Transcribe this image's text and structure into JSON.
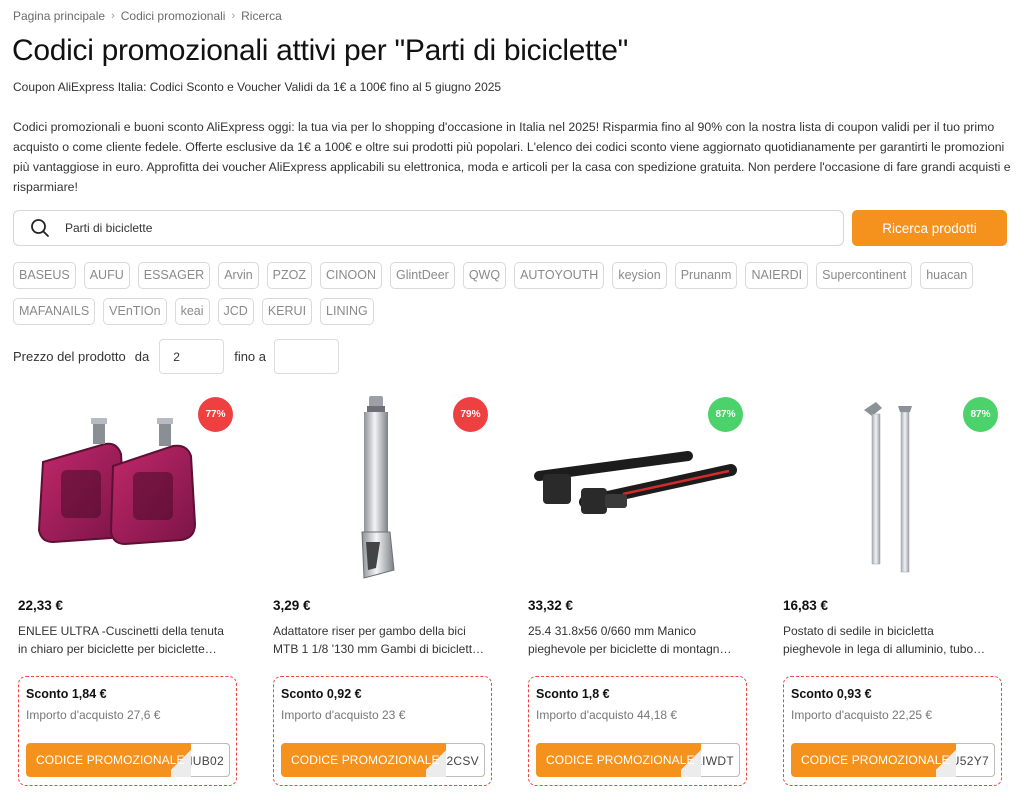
{
  "breadcrumb": {
    "items": [
      "Pagina principale",
      "Codici promozionali",
      "Ricerca"
    ],
    "separator": ">"
  },
  "page": {
    "title": "Codici promozionali attivi per \"Parti di biciclette\"",
    "subtitle": "Coupon AliExpress Italia: Codici Sconto e Voucher Validi da 1€ a 100€ fino al 5 giugno 2025",
    "intro": "Codici promozionali e buoni sconto AliExpress oggi: la tua via per lo shopping d'occasione in Italia nel 2025! Risparmia fino al 90% con la nostra lista di coupon validi per il tuo primo acquisto o come cliente fedele. Offerte esclusive da 1€ a 100€ e oltre sui prodotti più popolari. L'elenco dei codici sconto viene aggiornato quotidianamente per garantirti le promozioni più vantaggiose in euro. Approfitta dei voucher AliExpress applicabili su elettronica, moda e articoli per la casa con spedizione gratuita. Non perdere l'occasione di fare grandi acquisti e risparmiare!"
  },
  "search": {
    "value": "Parti di biciclette",
    "button_label": "Ricerca prodotti",
    "icon": "search-icon"
  },
  "brands": {
    "row1": [
      "BASEUS",
      "AUFU",
      "ESSAGER",
      "Arvin",
      "PZOZ",
      "CINOON",
      "GlintDeer",
      "QWQ",
      "AUTOYOUTH",
      "keysion",
      "Prunanm",
      "NAIERDI",
      "Supercontinent",
      "huacan"
    ],
    "row2": [
      "MAFANAILS",
      "VEnTIOn",
      "keai",
      "JCD",
      "KERUI",
      "LINING"
    ]
  },
  "price_filter": {
    "label": "Prezzo del prodotto",
    "from_label": "da",
    "from_value": "2",
    "to_label": "fino a",
    "to_value": ""
  },
  "colors": {
    "accent": "#f5921e",
    "badge_red": "#ee4040",
    "badge_green": "#4cd26b",
    "coupon_border": "#e44444"
  },
  "products": [
    {
      "badge": "77%",
      "badge_color": "red",
      "price": "22,33 €",
      "title_line1": "ENLEE ULTRA -Cuscinetti della tenuta",
      "title_line2": "in chiaro per biciclette per biciclette…",
      "discount": "Sconto 1,84 €",
      "min_purchase": "Importo d'acquisto 27,6 €",
      "code_label": "CODICE PROMOZIONALE",
      "code": "HUB02",
      "image": "pedals-image"
    },
    {
      "badge": "79%",
      "badge_color": "red",
      "price": "3,29 €",
      "title_line1": "Adattatore riser per gambo della bici",
      "title_line2": "MTB 1 1/8 '130 mm Gambi di biciclett…",
      "discount": "Sconto 0,92 €",
      "min_purchase": "Importo d'acquisto 23 €",
      "code_label": "CODICE PROMOZIONALE",
      "code": "F2CSV",
      "image": "stem-riser-image"
    },
    {
      "badge": "87%",
      "badge_color": "green",
      "price": "33,32 €",
      "title_line1": "25.4 31.8x56 0/660 mm Manico",
      "title_line2": "pieghevole per biciclette di montagn…",
      "discount": "Sconto 1,8 €",
      "min_purchase": "Importo d'acquisto 44,18 €",
      "code_label": "CODICE PROMOZIONALE",
      "code": "KIWDT",
      "image": "folding-handlebar-image"
    },
    {
      "badge": "87%",
      "badge_color": "green",
      "price": "16,83 €",
      "title_line1": "Postato di sedile in bicicletta",
      "title_line2": "pieghevole in lega di alluminio, tubo…",
      "discount": "Sconto 0,93 €",
      "min_purchase": "Importo d'acquisto 22,25 €",
      "code_label": "CODICE PROMOZIONALE",
      "code": "0U52Y7",
      "image": "seatpost-image"
    }
  ]
}
